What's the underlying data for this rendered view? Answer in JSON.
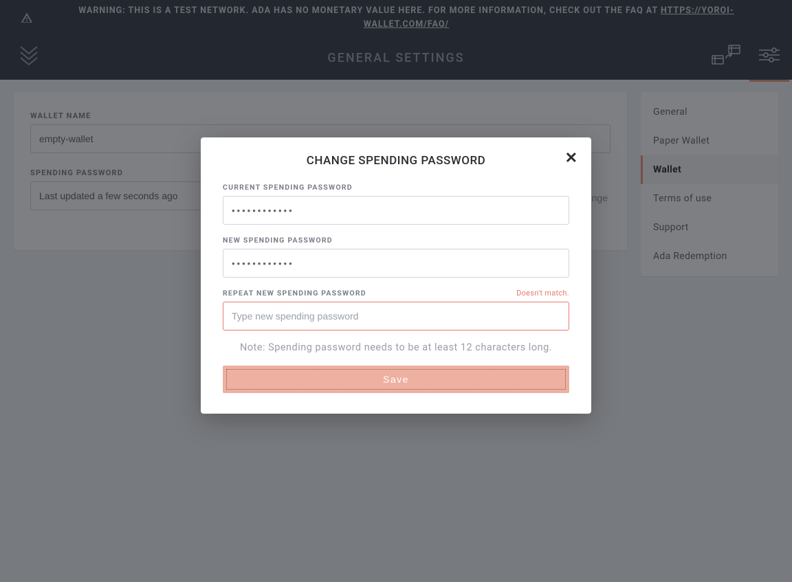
{
  "warning": {
    "prefix": "WARNING: THIS IS A TEST NETWORK. ADA HAS NO MONETARY VALUE HERE. FOR MORE INFORMATION, CHECK OUT THE FAQ AT ",
    "link_text": "HTTPS://YOROI-WALLET.COM/FAQ/"
  },
  "header": {
    "title": "GENERAL SETTINGS"
  },
  "settings": {
    "wallet_name_label": "WALLET NAME",
    "wallet_name_value": "empty-wallet",
    "spending_password_label": "SPENDING PASSWORD",
    "spending_password_status": "Last updated a few seconds ago",
    "change_label": "change"
  },
  "sidebar": {
    "items": [
      {
        "label": "General"
      },
      {
        "label": "Paper Wallet"
      },
      {
        "label": "Wallet"
      },
      {
        "label": "Terms of use"
      },
      {
        "label": "Support"
      },
      {
        "label": "Ada Redemption"
      }
    ],
    "active_index": 2
  },
  "modal": {
    "title": "CHANGE SPENDING PASSWORD",
    "current_label": "CURRENT SPENDING PASSWORD",
    "current_value": "••••••••••••",
    "new_label": "NEW SPENDING PASSWORD",
    "new_value": "••••••••••••",
    "repeat_label": "REPEAT NEW SPENDING PASSWORD",
    "repeat_placeholder": "Type new spending password",
    "repeat_error": "Doesn't match.",
    "note": "Note: Spending password needs to be at least 12 characters long.",
    "save_label": "Save"
  },
  "colors": {
    "accent": "#ee9884"
  }
}
